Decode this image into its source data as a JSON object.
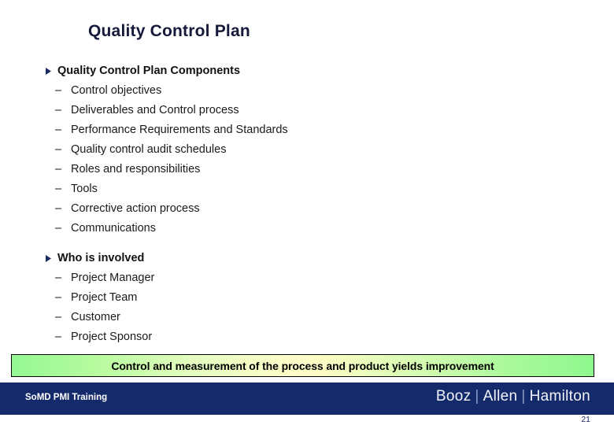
{
  "slide": {
    "title": "Quality Control Plan",
    "page_number": "21"
  },
  "content": {
    "groups": [
      {
        "heading": "Quality Control Plan Components",
        "marker": "triangle-right-icon",
        "items": [
          "Control objectives",
          "Deliverables and Control process",
          "Performance Requirements and Standards",
          "Quality control audit schedules",
          "Roles and responsibilities",
          "Tools",
          "Corrective action process",
          "Communications"
        ]
      },
      {
        "heading": "Who is involved",
        "marker": "triangle-right-icon",
        "items": [
          "Project Manager",
          "Project Team",
          "Customer",
          "Project Sponsor"
        ]
      }
    ],
    "sub_marker": "–"
  },
  "callout": {
    "text": "Control and measurement of the process and product yields improvement",
    "gradient_edge_color": "#93f893",
    "gradient_center_color": "#fdfdc8",
    "border_color": "#000000"
  },
  "footer": {
    "left_label": "SoMD PMI Training",
    "logo_parts": [
      "Booz",
      "Allen",
      "Hamilton"
    ],
    "logo_separator": "|",
    "background_color": "#152a6b",
    "text_color": "#ffffff"
  }
}
